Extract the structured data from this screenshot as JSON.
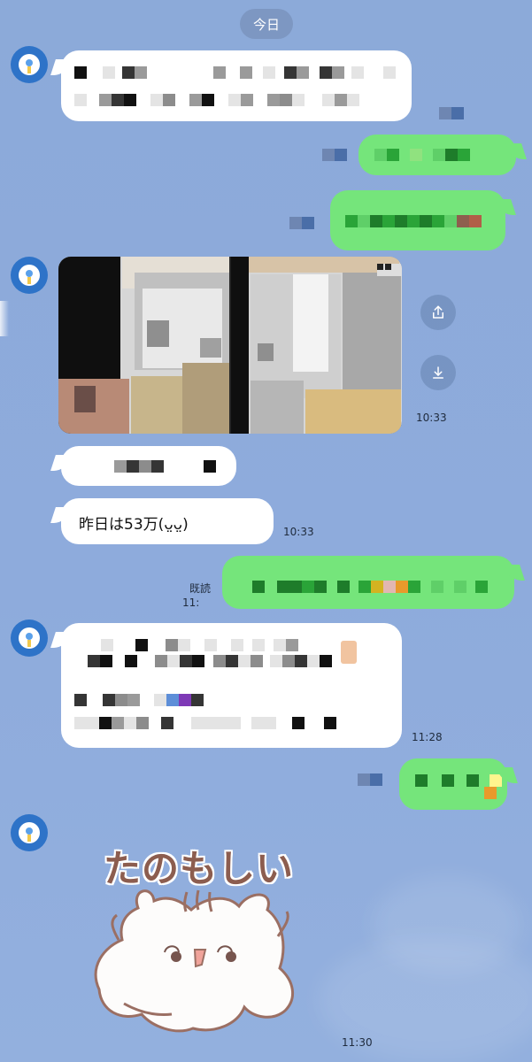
{
  "chat": {
    "date_label": "今日",
    "messages": {
      "incoming_text_1": "昨日は53万(ᴗ̤ᴗ̤)",
      "time_incoming_text_1": "10:33",
      "read_label": "既読",
      "time_outgoing_read": "11:",
      "time_incoming_pixel_block": "11:28",
      "time_sticker": "11:30",
      "sticker_text": "たのもしい",
      "time_image_message": "10:33"
    },
    "icons": {
      "share": "share-icon",
      "download": "download-icon",
      "avatar": "bulb-avatar-icon"
    },
    "colors": {
      "background": "#8fabd9",
      "incoming_bubble": "#ffffff",
      "outgoing_bubble": "#75e57b",
      "avatar": "#2e73c8",
      "sticker_text": "#8c5d4f"
    }
  }
}
